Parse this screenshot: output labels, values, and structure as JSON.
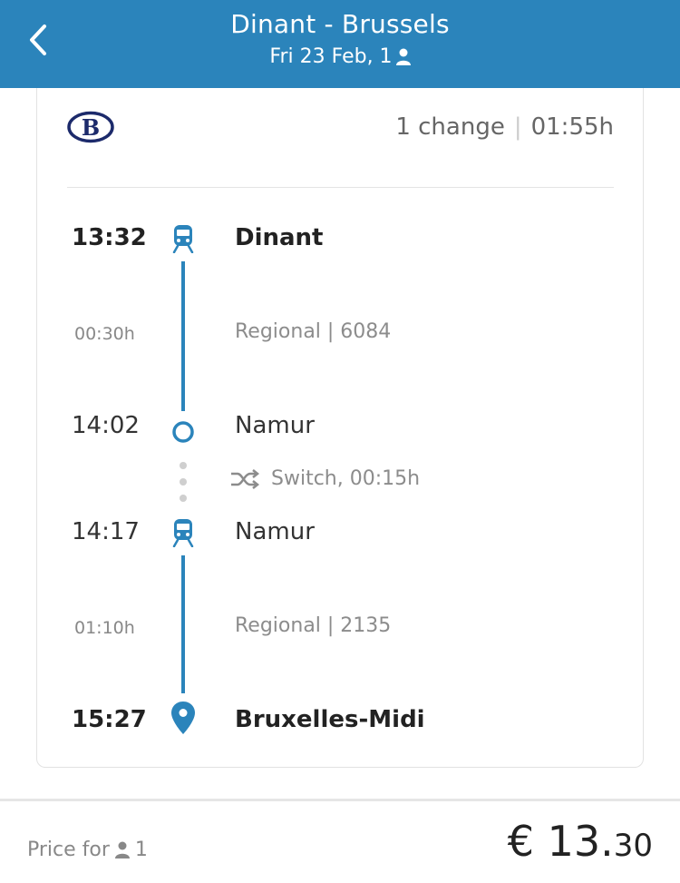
{
  "header": {
    "title": "Dinant - Brussels",
    "subtitle": "Fri 23 Feb, 1",
    "color": "#2b84bb"
  },
  "card": {
    "operator_icon": "sncb-logo-icon",
    "summary_changes": "1 change",
    "summary_duration": "01:55h"
  },
  "journey": {
    "stop1": {
      "time": "13:32",
      "station": "Dinant"
    },
    "leg1": {
      "duration": "00:30h",
      "service": "Regional | 6084"
    },
    "stop2": {
      "time": "14:02",
      "station": "Namur"
    },
    "switch": "Switch, 00:15h",
    "stop3": {
      "time": "14:17",
      "station": "Namur"
    },
    "leg2": {
      "duration": "01:10h",
      "service": "Regional | 2135"
    },
    "stop4": {
      "time": "15:27",
      "station": "Bruxelles-Midi"
    }
  },
  "footer": {
    "price_label": "Price for",
    "passengers": "1",
    "price_main": "€ 13.",
    "price_cents": "30"
  }
}
